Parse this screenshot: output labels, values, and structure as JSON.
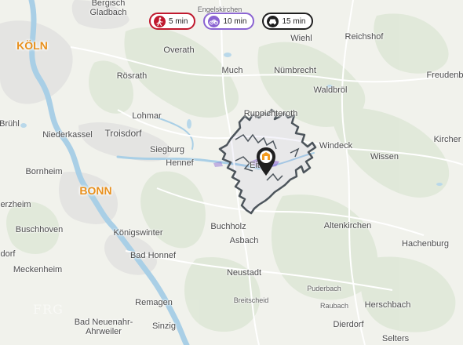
{
  "filters": {
    "walk": {
      "label": "5 min",
      "icon": "walk-icon",
      "color": "#c0192e"
    },
    "bike": {
      "label": "10 min",
      "icon": "bicycle-icon",
      "color": "#8a63d2"
    },
    "car": {
      "label": "15 min",
      "icon": "car-icon",
      "color": "#1f1f1f"
    }
  },
  "cities": {
    "koln": "KÖLN",
    "bonn": "BONN"
  },
  "places": {
    "bergisch": "Bergisch\nGladbach",
    "engelskirchen": "Engelskirchen",
    "overath": "Overath",
    "much": "Much",
    "wiehl": "Wiehl",
    "reichshof": "Reichshof",
    "rosrath": "Rösrath",
    "numbrecht": "Nümbrecht",
    "waldbrol": "Waldbröl",
    "freudenberg": "Freudenb",
    "lohmar": "Lohmar",
    "ruppichteroth": "Ruppichteroth",
    "bruhl": "Brühl",
    "niederkassel": "Niederkassel",
    "troisdorf": "Troisdorf",
    "windeck": "Windeck",
    "kirchen": "Kircher",
    "siegburg": "Siegburg",
    "hennef": "Hennef",
    "eitorf": "Eitorf",
    "wissen": "Wissen",
    "bornheim": "Bornheim",
    "merzheim": "erzheim",
    "buschhoven": "Buschhoven",
    "konigswinter": "Königswinter",
    "buchholz": "Buchholz",
    "asbach": "Asbach",
    "altenkirchen": "Altenkirchen",
    "dorf": "dorf",
    "badhonnef": "Bad Honnef",
    "hachenburg": "Hachenburg",
    "meckenheim": "Meckenheim",
    "neustadt": "Neustadt",
    "breitscheid": "Breitscheid",
    "puderbach": "Puderbach",
    "remagen": "Remagen",
    "raubach": "Raubach",
    "herschbach": "Herschbach",
    "badneuenahr": "Bad Neuenahr-\nAhrweiler",
    "sinzig": "Sinzig",
    "dierdorf": "Dierdorf",
    "selters": "Selters"
  },
  "watermark": "FRG",
  "colors": {
    "isochrone": "#4d555c",
    "river": "#a9cfe6",
    "forest": "#dfe8d9",
    "urban": "#e2e2e2",
    "city_label": "#e8901d",
    "marker": "#1f1f1f",
    "marker_inner": "#f39a1e"
  },
  "marker_icon": "location-pin-icon"
}
